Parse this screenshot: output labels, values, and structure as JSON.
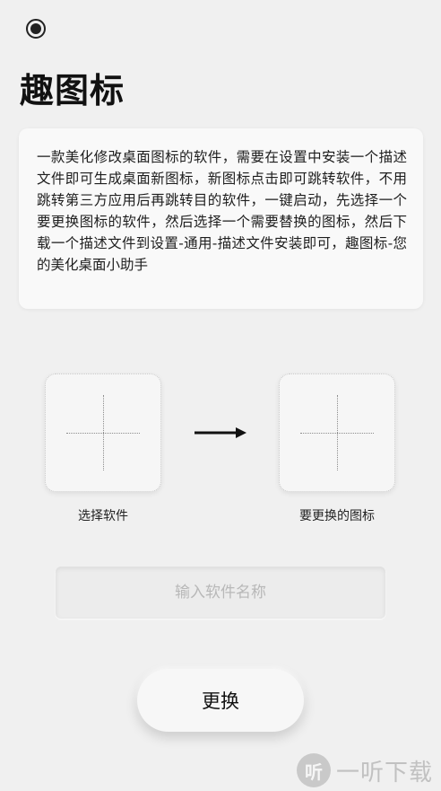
{
  "header": {
    "title": "趣图标"
  },
  "description": {
    "text": "一款美化修改桌面图标的软件，需要在设置中安装一个描述文件即可生成桌面新图标，新图标点击即可跳转软件，不用跳转第三方应用后再跳转目的软件，一键启动，先选择一个要更换图标的软件，然后选择一个需要替换的图标，然后下载一个描述文件到设置-通用-描述文件安装即可，趣图标-您的美化桌面小助手"
  },
  "pickers": {
    "left_label": "选择软件",
    "right_label": "要更换的图标"
  },
  "input": {
    "value": "",
    "placeholder": "输入软件名称"
  },
  "actions": {
    "confirm_label": "更换"
  },
  "watermark": {
    "logo_char": "听",
    "text": "一听下载"
  },
  "colors": {
    "background": "#f0f0f0",
    "card": "#f9f9f9",
    "text": "#1a1a1a",
    "placeholder": "#b8b8b8"
  }
}
